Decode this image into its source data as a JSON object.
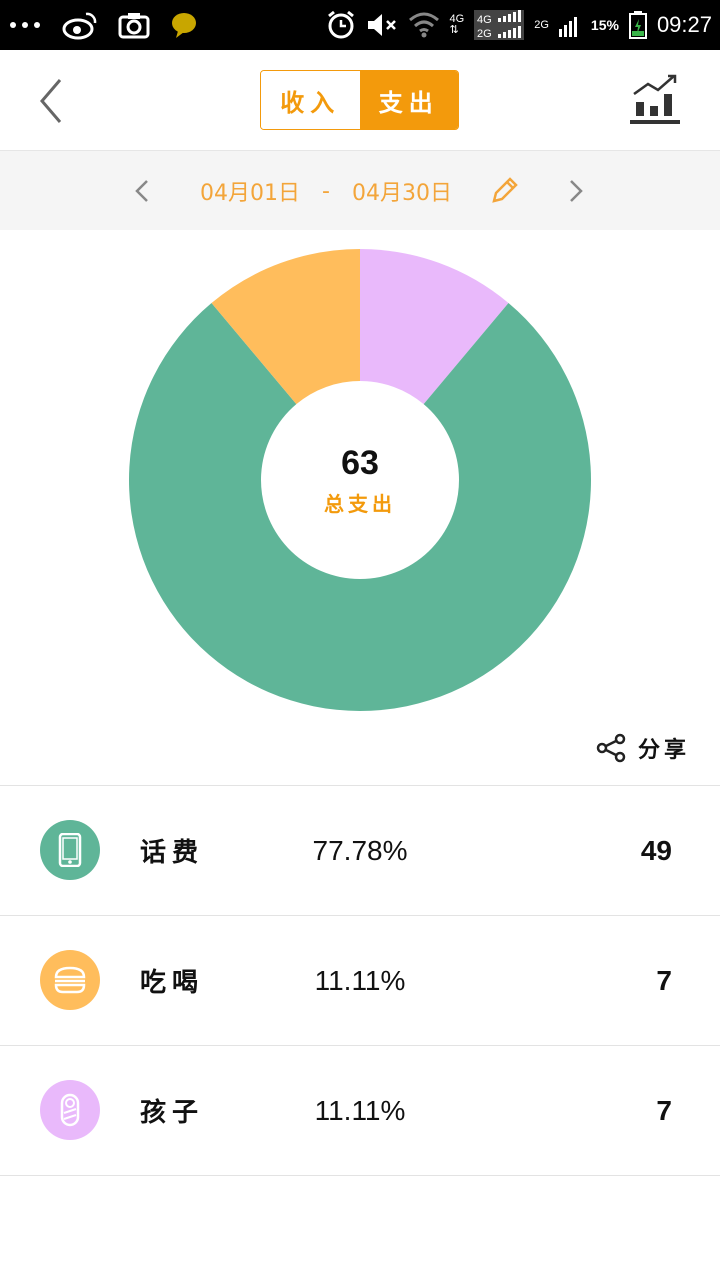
{
  "status_bar": {
    "time": "09:27",
    "battery_percent": "15%",
    "net_4g": "4G",
    "net_2g": "2G",
    "icons": [
      "more-dots-icon",
      "weibo-icon",
      "camera-icon",
      "chat-bubble-icon",
      "alarm-icon",
      "mute-icon",
      "wifi-icon",
      "signal-icon",
      "battery-icon"
    ]
  },
  "header": {
    "tabs": [
      {
        "label": "收入",
        "selected": false
      },
      {
        "label": "支出",
        "selected": true
      }
    ],
    "back_icon": "chevron-left-icon",
    "trend_icon": "bar-trend-icon"
  },
  "date_range": {
    "start": "04月01日",
    "separator": "-",
    "end": "04月30日"
  },
  "summary": {
    "total": "63",
    "label": "总支出"
  },
  "share": {
    "label": "分享"
  },
  "colors": {
    "accent": "#f39a0c",
    "phone": "#5fb598",
    "food": "#ffbd5c",
    "kids": "#e9b9fb"
  },
  "categories": [
    {
      "name": "话费",
      "percent": "77.78%",
      "amount": "49",
      "icon": "phone-icon",
      "color": "#5fb598"
    },
    {
      "name": "吃喝",
      "percent": "11.11%",
      "amount": "7",
      "icon": "burger-icon",
      "color": "#ffbd5c"
    },
    {
      "name": "孩子",
      "percent": "11.11%",
      "amount": "7",
      "icon": "baby-icon",
      "color": "#e9b9fb"
    }
  ],
  "chart_data": {
    "type": "pie",
    "categories": [
      "话费",
      "吃喝",
      "孩子"
    ],
    "values": [
      49,
      7,
      7
    ],
    "colors": [
      "#5fb598",
      "#ffbd5c",
      "#e9b9fb"
    ],
    "donut": true,
    "center_value": "63",
    "center_label": "总支出"
  }
}
